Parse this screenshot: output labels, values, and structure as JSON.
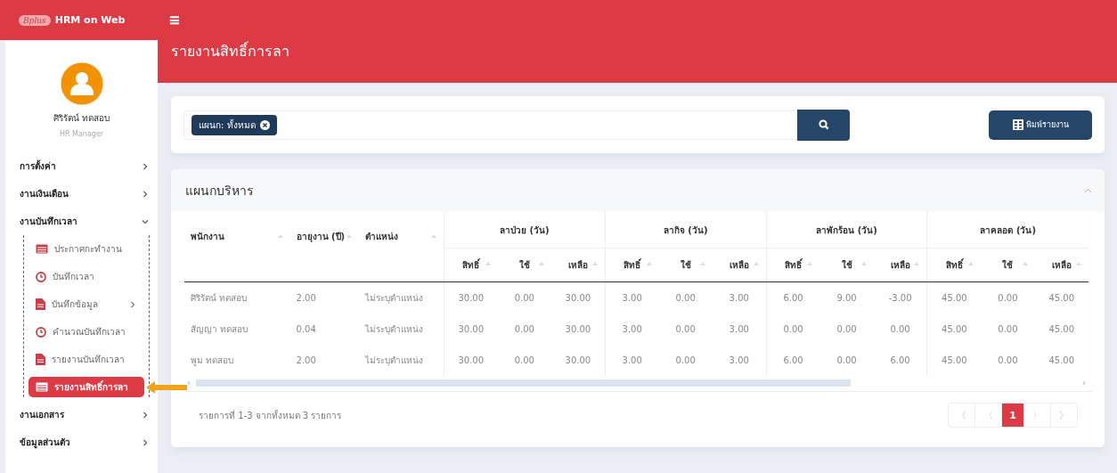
{
  "app": {
    "logo": "Bplus",
    "title": "HRM on Web",
    "menu_glyph": "≡"
  },
  "user": {
    "name": "ศิริรัตน์ ทดสอบ",
    "role": "HR Manager"
  },
  "sidebar": {
    "items": [
      {
        "label": "การตั้งค่า",
        "expanded": false
      },
      {
        "label": "งานเงินเดือน",
        "expanded": false
      },
      {
        "label": "งานบันทึกเวลา",
        "expanded": true,
        "children": [
          {
            "label": "ประกาศกะทำงาน",
            "selected": false,
            "expandable": false
          },
          {
            "label": "บันทึกเวลา",
            "selected": false,
            "expandable": false
          },
          {
            "label": "บันทึกข้อมูล",
            "selected": false,
            "expandable": true
          },
          {
            "label": "คำนวณบันทึกเวลา",
            "selected": false,
            "expandable": false
          },
          {
            "label": "รายงานบันทึกเวลา",
            "selected": false,
            "expandable": false
          },
          {
            "label": "รายงานสิทธิ์การลา",
            "selected": true,
            "expandable": false
          }
        ]
      },
      {
        "label": "งานเอกสาร",
        "expanded": false
      },
      {
        "label": "ข้อมูลส่วนตัว",
        "expanded": false
      }
    ]
  },
  "page": {
    "title": "รายงานสิทธิ์การลา"
  },
  "filter": {
    "tag": "แผนก: ทั้งหมด",
    "print_button": "พิมพ์รายงาน"
  },
  "panel": {
    "title": "แผนกบริหาร",
    "expanded": true
  },
  "table": {
    "columns": [
      "พนักงาน",
      "อายุงาน (ปี)",
      "ตำแหน่ง"
    ],
    "groups": [
      {
        "label": "ลาป่วย (วัน)",
        "subcolumns": [
          "สิทธิ์",
          "ใช้",
          "เหลือ"
        ]
      },
      {
        "label": "ลากิจ (วัน)",
        "subcolumns": [
          "สิทธิ์",
          "ใช้",
          "เหลือ"
        ]
      },
      {
        "label": "ลาพักร้อน (วัน)",
        "subcolumns": [
          "สิทธิ์",
          "ใช้",
          "เหลือ"
        ]
      },
      {
        "label": "ลาคลอด (วัน)",
        "subcolumns": [
          "สิทธิ์",
          "ใช้",
          "เหลือ"
        ]
      }
    ],
    "rows": [
      [
        "ศิริรัตน์ ทดสอบ",
        "2.00",
        "ไม่ระบุตำแหน่ง",
        "30.00",
        "0.00",
        "30.00",
        "3.00",
        "0.00",
        "3.00",
        "6.00",
        "9.00",
        "-3.00",
        "45.00",
        "0.00",
        "45.00"
      ],
      [
        "สัญญา ทดสอบ",
        "0.04",
        "ไม่ระบุตำแหน่ง",
        "30.00",
        "0.00",
        "30.00",
        "3.00",
        "0.00",
        "3.00",
        "0.00",
        "0.00",
        "0.00",
        "45.00",
        "0.00",
        "45.00"
      ],
      [
        "พูม ทดสอบ",
        "2.00",
        "ไม่ระบุตำแหน่ง",
        "30.00",
        "0.00",
        "30.00",
        "3.00",
        "0.00",
        "3.00",
        "6.00",
        "0.00",
        "6.00",
        "45.00",
        "0.00",
        "45.00"
      ]
    ]
  },
  "footer": {
    "summary": "รายการที่ 1-3 จากทั้งหมด 3 รายการ",
    "pages": [
      {
        "label": "《",
        "selected": false
      },
      {
        "label": "〈",
        "selected": false
      },
      {
        "label": "1",
        "selected": true
      },
      {
        "label": "〉",
        "selected": false
      },
      {
        "label": "》",
        "selected": false
      }
    ]
  }
}
